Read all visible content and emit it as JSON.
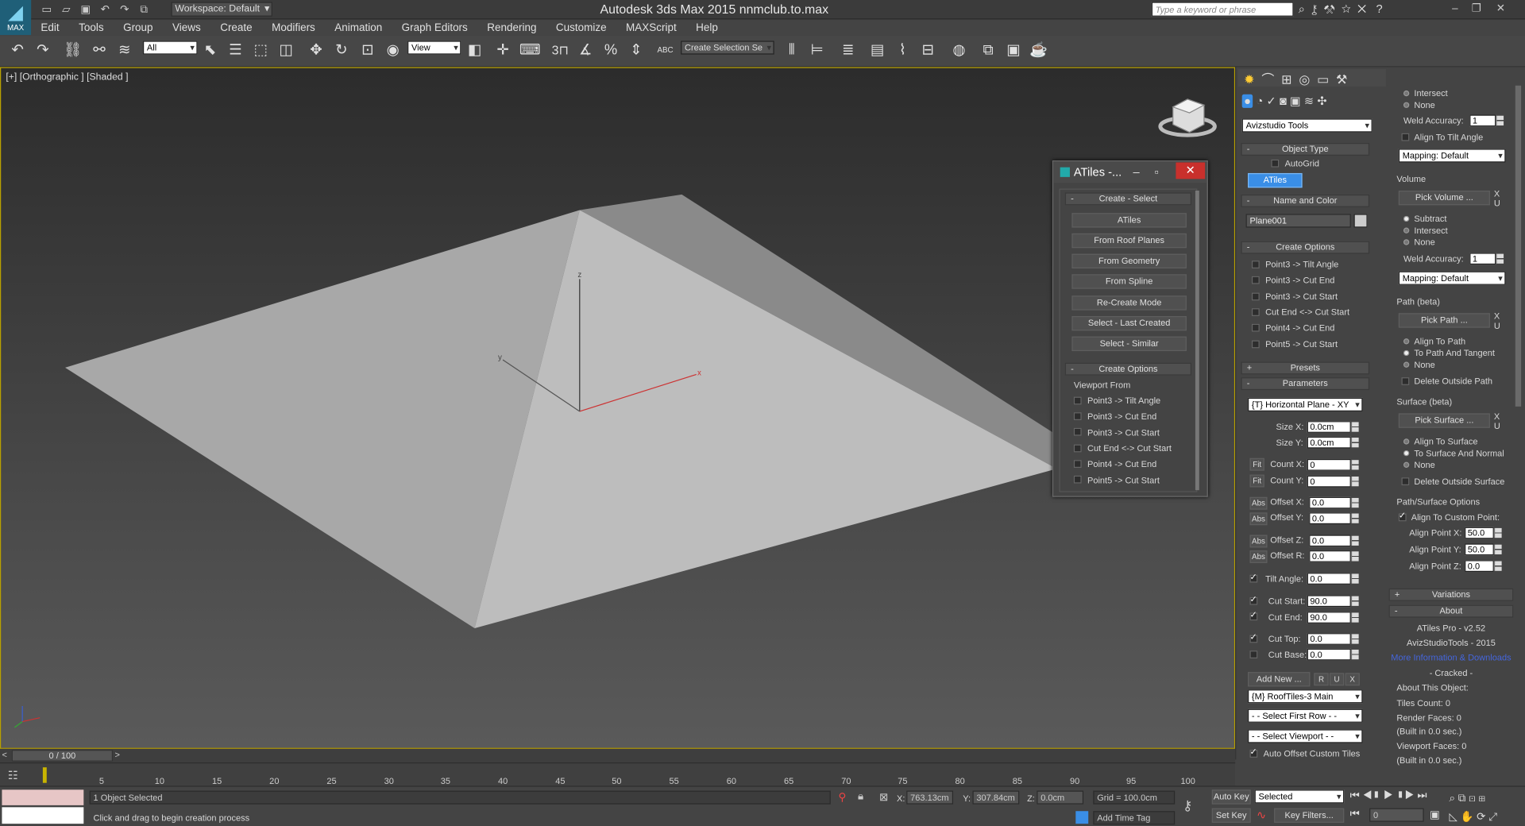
{
  "title_bar": {
    "app_title": "Autodesk 3ds Max  2015     nnmclub.to.max",
    "workspace": "Workspace: Default",
    "search_placeholder": "Type a keyword or phrase",
    "logo_text": "MAX"
  },
  "menu": [
    "Edit",
    "Tools",
    "Group",
    "Views",
    "Create",
    "Modifiers",
    "Animation",
    "Graph Editors",
    "Rendering",
    "Customize",
    "MAXScript",
    "Help"
  ],
  "toolbar": {
    "filter": "All",
    "ref_coord": "View",
    "selection_set": "Create Selection Se",
    "snap_3": "3",
    "snap_abc": "ABC"
  },
  "viewport": {
    "label": "[+] [Orthographic ] [Shaded ]",
    "axis_x": "x",
    "axis_y": "y",
    "axis_z": "z"
  },
  "command_panel": {
    "category": "Avizstudio Tools",
    "object_type": "Object Type",
    "autogrid": "AutoGrid",
    "atiles_btn": "ATiles",
    "name_and_color": "Name and Color",
    "object_name": "Plane001",
    "create_options": "Create Options",
    "options": [
      "Point3 -> Tilt Angle",
      "Point3 -> Cut End",
      "Point3 -> Cut Start",
      "Cut End <-> Cut Start",
      "Point4 -> Cut End",
      "Point5 -> Cut Start"
    ],
    "presets": "Presets",
    "parameters": "Parameters",
    "plane": "{T} Horizontal Plane - XY",
    "size_x_label": "Size X:",
    "size_x": "0.0cm",
    "size_y_label": "Size Y:",
    "size_y": "0.0cm",
    "fit": "Fit",
    "count_x_label": "Count X:",
    "count_x": "0",
    "count_y_label": "Count Y:",
    "count_y": "0",
    "abs": "Abs",
    "offset_x_label": "Offset X:",
    "offset_x": "0.0",
    "offset_y_label": "Offset Y:",
    "offset_y": "0.0",
    "offset_z_label": "Offset Z:",
    "offset_z": "0.0",
    "offset_r_label": "Offset R:",
    "offset_r": "0.0",
    "tilt_angle_label": "Tilt Angle:",
    "tilt_angle": "0.0",
    "cut_start_label": "Cut Start:",
    "cut_start": "90.0",
    "cut_end_label": "Cut End:",
    "cut_end": "90.0",
    "cut_top_label": "Cut Top:",
    "cut_top": "0.0",
    "cut_base_label": "Cut Base:",
    "cut_base": "0.0",
    "add_new": "Add New ...",
    "r": "R",
    "u": "U",
    "x": "X",
    "preset_main": "{M} RoofTiles-3 Main",
    "select_first_row": "- - Select First Row - -",
    "select_viewport": "- - Select Viewport - -",
    "auto_offset": "Auto Offset Custom Tiles"
  },
  "right_panel": {
    "intersect": "Intersect",
    "none": "None",
    "weld_accuracy": "Weld Accuracy:",
    "weld_value": "1",
    "align_tilt": "Align To Tilt Angle",
    "mapping": "Mapping: Default",
    "volume": "Volume",
    "pick_volume": "Pick Volume ...",
    "subtract": "Subtract",
    "path_beta": "Path (beta)",
    "pick_path": "Pick Path ...",
    "align_path": "Align To Path",
    "path_tangent": "To Path And Tangent",
    "delete_outside_path": "Delete Outside Path",
    "surface_beta": "Surface (beta)",
    "pick_surface": "Pick Surface ...",
    "align_surface": "Align To Surface",
    "surface_normal": "To Surface And Normal",
    "delete_outside_surface": "Delete Outside Surface",
    "path_surface_options": "Path/Surface Options",
    "align_custom": "Align To Custom Point:",
    "align_x_label": "Align Point X:",
    "align_x": "50.0",
    "align_y_label": "Align Point Y:",
    "align_y": "50.0",
    "align_z_label": "Align Point Z:",
    "align_z": "0.0",
    "variations": "Variations",
    "about": "About",
    "version": "ATiles Pro - v2.52",
    "company": "AvizStudioTools - 2015",
    "more_info": "More Information & Downloads",
    "cracked": "- Cracked -",
    "about_object": "About This Object:",
    "tiles_count": "Tiles Count: 0",
    "render_faces": "Render Faces: 0",
    "built1": "(Built in 0.0 sec.)",
    "viewport_faces": "Viewport Faces: 0",
    "built2": "(Built in 0.0 sec.)",
    "x_btn": "X",
    "u_btn": "U"
  },
  "atiles_dialog": {
    "title": "ATiles -...",
    "create_select": "Create - Select",
    "buttons": [
      "ATiles",
      "From Roof Planes",
      "From Geometry",
      "From Spline",
      "Re-Create Mode",
      "Select - Last Created",
      "Select - Similar"
    ],
    "create_options": "Create Options",
    "viewport_from": "Viewport From",
    "options": [
      "Point3 -> Tilt Angle",
      "Point3 -> Cut End",
      "Point3 -> Cut Start",
      "Cut End <-> Cut Start",
      "Point4 -> Cut End",
      "Point5 -> Cut Start"
    ]
  },
  "timeline": {
    "frame": "0 / 100",
    "ticks": [
      "5",
      "10",
      "15",
      "20",
      "25",
      "30",
      "35",
      "40",
      "45",
      "50",
      "55",
      "60",
      "65",
      "70",
      "75",
      "80",
      "85",
      "90",
      "95",
      "100"
    ]
  },
  "status": {
    "selected": "1 Object Selected",
    "prompt": "Click and drag to begin creation process",
    "x_label": "X:",
    "x": "763.13cm",
    "y_label": "Y:",
    "y": "307.84cm",
    "z_label": "Z:",
    "z": "0.0cm",
    "grid": "Grid = 100.0cm",
    "add_time_tag": "Add Time Tag",
    "auto_key": "Auto Key",
    "set_key": "Set Key",
    "key_mode": "Selected",
    "key_filters": "Key Filters...",
    "frame_field": "0"
  },
  "colors": {
    "accent": "#3a8ee6",
    "viewport_border": "#b8a000",
    "close": "#c9302c"
  }
}
